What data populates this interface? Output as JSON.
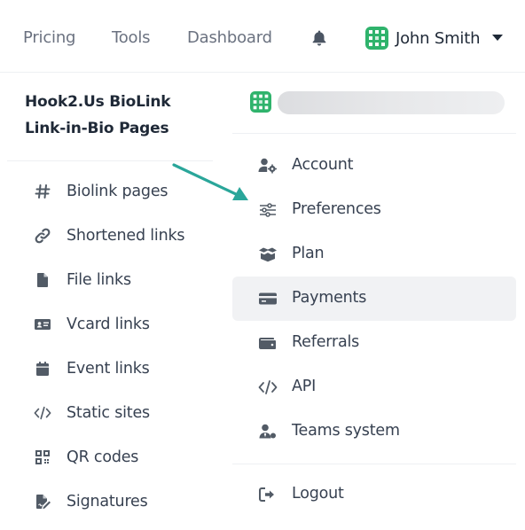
{
  "topnav": {
    "links": [
      "Pricing",
      "Tools",
      "Dashboard"
    ],
    "user_name": "John Smith"
  },
  "sidebar": {
    "brand_line1": "Hook2.Us BioLink",
    "brand_line2": "Link-in-Bio Pages",
    "items": [
      {
        "label": "Biolink pages",
        "icon": "hashtag-icon"
      },
      {
        "label": "Shortened links",
        "icon": "link-icon"
      },
      {
        "label": "File links",
        "icon": "file-icon"
      },
      {
        "label": "Vcard links",
        "icon": "id-card-icon"
      },
      {
        "label": "Event links",
        "icon": "calendar-icon"
      },
      {
        "label": "Static sites",
        "icon": "code-icon"
      },
      {
        "label": "QR codes",
        "icon": "qrcode-icon"
      },
      {
        "label": "Signatures",
        "icon": "file-signature-icon"
      }
    ]
  },
  "dropdown": {
    "items": [
      {
        "label": "Account",
        "icon": "user-cog-icon"
      },
      {
        "label": "Preferences",
        "icon": "sliders-icon"
      },
      {
        "label": "Plan",
        "icon": "box-open-icon"
      },
      {
        "label": "Payments",
        "icon": "credit-card-icon",
        "active": true
      },
      {
        "label": "Referrals",
        "icon": "wallet-icon"
      },
      {
        "label": "API",
        "icon": "code-icon"
      },
      {
        "label": "Teams system",
        "icon": "user-tie-icon"
      }
    ],
    "logout_label": "Logout"
  },
  "colors": {
    "accent_arrow": "#2aa69a",
    "avatar": "#2fb36c",
    "icon": "#525b66",
    "active_bg": "#f1f2f4"
  }
}
